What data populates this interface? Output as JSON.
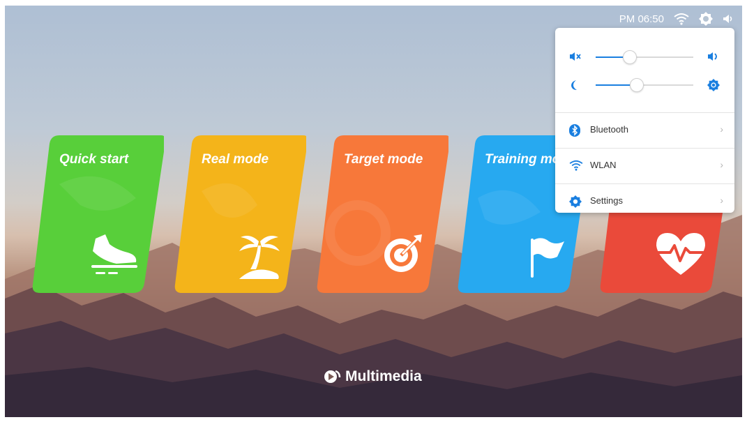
{
  "status_bar": {
    "time": "PM 06:50",
    "icons": [
      "wifi-icon",
      "brightness-icon",
      "volume-icon"
    ]
  },
  "cards": [
    {
      "title": "Quick start",
      "icon": "sneaker-icon",
      "color": "#58cf3a"
    },
    {
      "title": "Real mode",
      "icon": "palm-island-icon",
      "color": "#f4b41a"
    },
    {
      "title": "Target mode",
      "icon": "target-icon",
      "color": "#f7783a"
    },
    {
      "title": "Training mo",
      "icon": "flag-icon",
      "color": "#27a9f0"
    },
    {
      "title": "",
      "icon": "heart-pulse-icon",
      "color": "#ea4a3a"
    }
  ],
  "quick_panel": {
    "volume_level": 0.35,
    "brightness_level": 0.42,
    "accent_color": "#1a7fe0",
    "items": [
      {
        "label": "Bluetooth",
        "icon": "bluetooth-icon"
      },
      {
        "label": "WLAN",
        "icon": "wifi-icon"
      },
      {
        "label": "Settings",
        "icon": "gear-icon"
      }
    ],
    "chevron": "›"
  },
  "footer": {
    "label": "Multimedia",
    "icon": "multimedia-icon"
  }
}
